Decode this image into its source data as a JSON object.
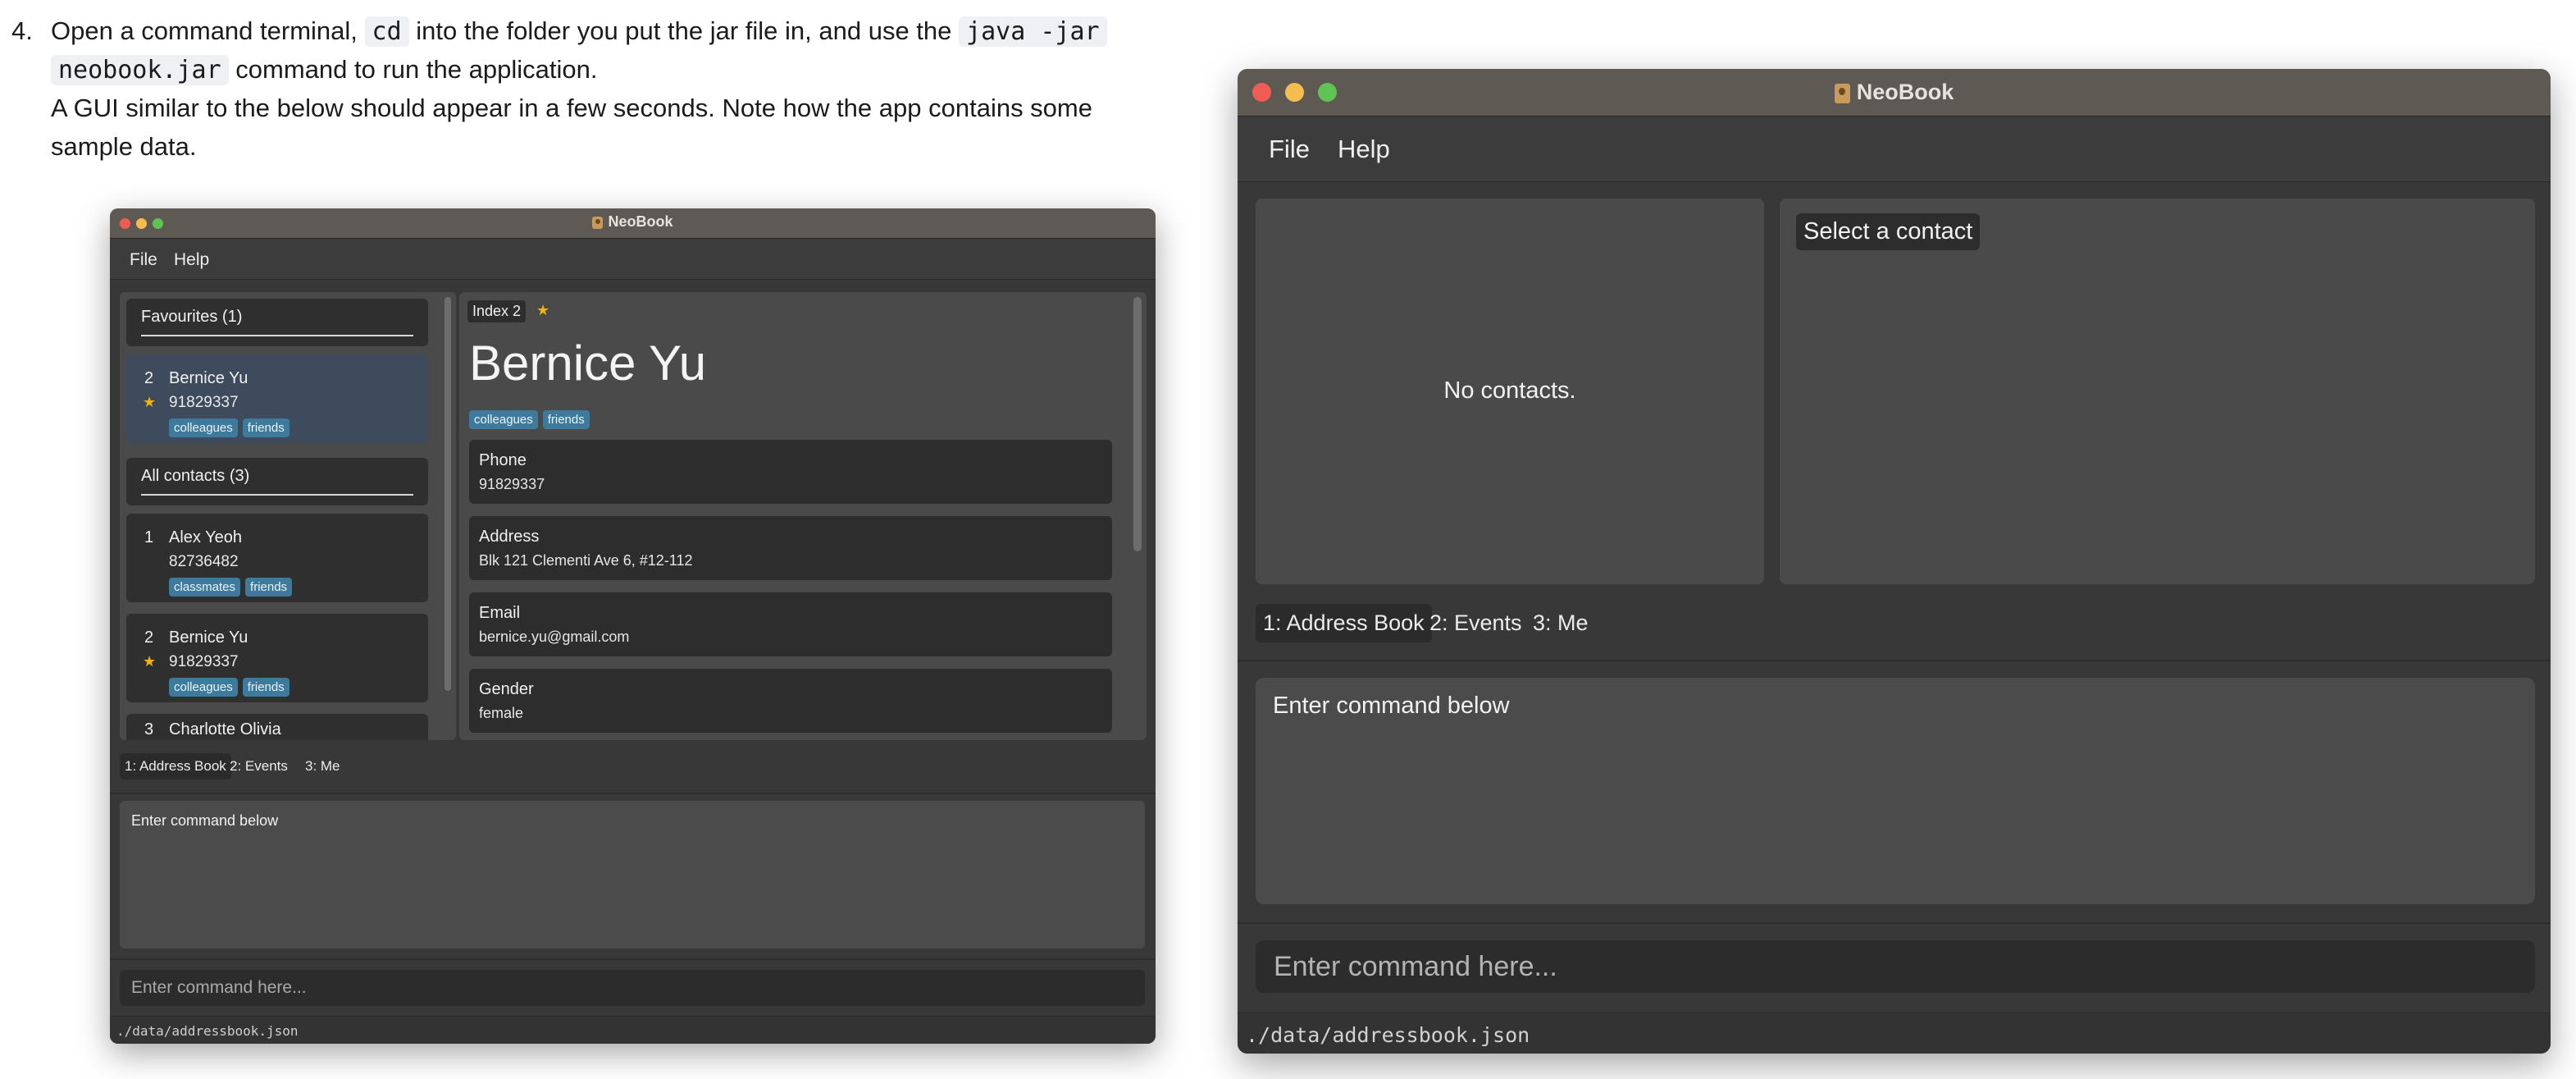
{
  "instructions": {
    "step_number": "4.",
    "line1_pre": "Open a command terminal, ",
    "line1_code1": "cd",
    "line1_mid": " into the folder you put the jar file in, and use the ",
    "line1_code2": "java -jar",
    "line2_code": "neobook.jar",
    "line2_post": " command to run the application.",
    "line3": "A GUI similar to the below should appear in a few seconds. Note how the app contains some",
    "line4": "sample data."
  },
  "colors": {
    "traffic_close": "#ee5c54",
    "traffic_minimize": "#f5bd4f",
    "traffic_maximize": "#5fc454",
    "favourite_star": "#f0b400",
    "tag": "#3e7a9c"
  },
  "small_window": {
    "title": "NeoBook",
    "menu": [
      "File",
      "Help"
    ],
    "favourites_header": "Favourites (1)",
    "all_contacts_header": "All contacts (3)",
    "favourites": [
      {
        "index": "2",
        "name": "Bernice Yu",
        "phone": "91829337",
        "star": "★",
        "tags": [
          "colleagues",
          "friends"
        ]
      }
    ],
    "contacts": [
      {
        "index": "1",
        "name": "Alex Yeoh",
        "phone": "82736482",
        "tags": [
          "classmates",
          "friends"
        ]
      },
      {
        "index": "2",
        "name": "Bernice Yu",
        "phone": "91829337",
        "star": "★",
        "tags": [
          "colleagues",
          "friends"
        ]
      },
      {
        "index": "3",
        "name": "Charlotte Olivia"
      }
    ],
    "detail": {
      "index_label": "Index 2",
      "star": "★",
      "name": "Bernice Yu",
      "tags": [
        "colleagues",
        "friends"
      ],
      "fields": [
        {
          "label": "Phone",
          "value": "91829337"
        },
        {
          "label": "Address",
          "value": "Blk 121 Clementi Ave 6, #12-112"
        },
        {
          "label": "Email",
          "value": "bernice.yu@gmail.com"
        },
        {
          "label": "Gender",
          "value": "female"
        }
      ]
    },
    "tabs": [
      "1: Address Book",
      "2: Events",
      "3: Me"
    ],
    "result_text": "Enter command below",
    "command_placeholder": "Enter command here...",
    "status_path": "./data/addressbook.json"
  },
  "large_window": {
    "title": "NeoBook",
    "menu": [
      "File",
      "Help"
    ],
    "empty_list_text": "No contacts.",
    "detail_placeholder": "Select a contact",
    "tabs": [
      "1: Address Book",
      "2: Events",
      "3: Me"
    ],
    "result_text": "Enter command below",
    "command_placeholder": "Enter command here...",
    "status_path": "./data/addressbook.json"
  }
}
